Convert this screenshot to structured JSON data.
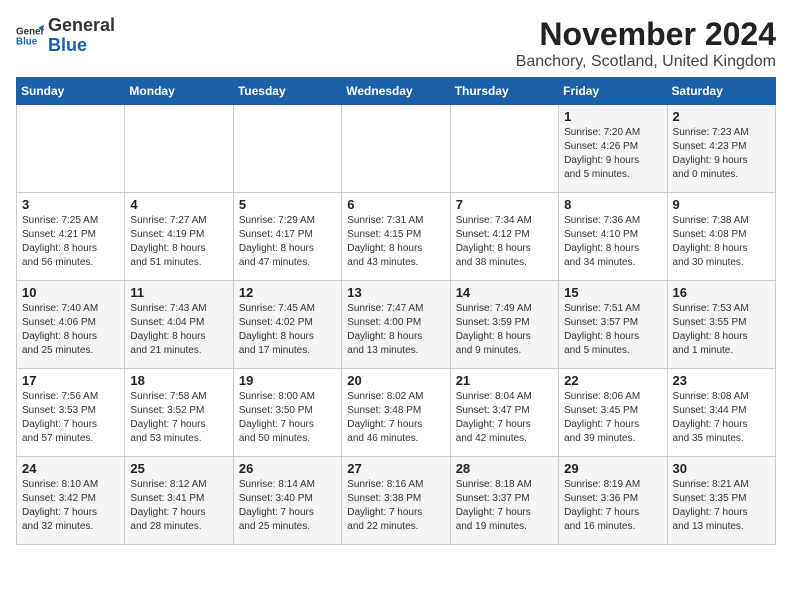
{
  "logo": {
    "general": "General",
    "blue": "Blue"
  },
  "title": "November 2024",
  "location": "Banchory, Scotland, United Kingdom",
  "days_header": [
    "Sunday",
    "Monday",
    "Tuesday",
    "Wednesday",
    "Thursday",
    "Friday",
    "Saturday"
  ],
  "weeks": [
    [
      {
        "day": "",
        "info": ""
      },
      {
        "day": "",
        "info": ""
      },
      {
        "day": "",
        "info": ""
      },
      {
        "day": "",
        "info": ""
      },
      {
        "day": "",
        "info": ""
      },
      {
        "day": "1",
        "info": "Sunrise: 7:20 AM\nSunset: 4:26 PM\nDaylight: 9 hours\nand 5 minutes."
      },
      {
        "day": "2",
        "info": "Sunrise: 7:23 AM\nSunset: 4:23 PM\nDaylight: 9 hours\nand 0 minutes."
      }
    ],
    [
      {
        "day": "3",
        "info": "Sunrise: 7:25 AM\nSunset: 4:21 PM\nDaylight: 8 hours\nand 56 minutes."
      },
      {
        "day": "4",
        "info": "Sunrise: 7:27 AM\nSunset: 4:19 PM\nDaylight: 8 hours\nand 51 minutes."
      },
      {
        "day": "5",
        "info": "Sunrise: 7:29 AM\nSunset: 4:17 PM\nDaylight: 8 hours\nand 47 minutes."
      },
      {
        "day": "6",
        "info": "Sunrise: 7:31 AM\nSunset: 4:15 PM\nDaylight: 8 hours\nand 43 minutes."
      },
      {
        "day": "7",
        "info": "Sunrise: 7:34 AM\nSunset: 4:12 PM\nDaylight: 8 hours\nand 38 minutes."
      },
      {
        "day": "8",
        "info": "Sunrise: 7:36 AM\nSunset: 4:10 PM\nDaylight: 8 hours\nand 34 minutes."
      },
      {
        "day": "9",
        "info": "Sunrise: 7:38 AM\nSunset: 4:08 PM\nDaylight: 8 hours\nand 30 minutes."
      }
    ],
    [
      {
        "day": "10",
        "info": "Sunrise: 7:40 AM\nSunset: 4:06 PM\nDaylight: 8 hours\nand 25 minutes."
      },
      {
        "day": "11",
        "info": "Sunrise: 7:43 AM\nSunset: 4:04 PM\nDaylight: 8 hours\nand 21 minutes."
      },
      {
        "day": "12",
        "info": "Sunrise: 7:45 AM\nSunset: 4:02 PM\nDaylight: 8 hours\nand 17 minutes."
      },
      {
        "day": "13",
        "info": "Sunrise: 7:47 AM\nSunset: 4:00 PM\nDaylight: 8 hours\nand 13 minutes."
      },
      {
        "day": "14",
        "info": "Sunrise: 7:49 AM\nSunset: 3:59 PM\nDaylight: 8 hours\nand 9 minutes."
      },
      {
        "day": "15",
        "info": "Sunrise: 7:51 AM\nSunset: 3:57 PM\nDaylight: 8 hours\nand 5 minutes."
      },
      {
        "day": "16",
        "info": "Sunrise: 7:53 AM\nSunset: 3:55 PM\nDaylight: 8 hours\nand 1 minute."
      }
    ],
    [
      {
        "day": "17",
        "info": "Sunrise: 7:56 AM\nSunset: 3:53 PM\nDaylight: 7 hours\nand 57 minutes."
      },
      {
        "day": "18",
        "info": "Sunrise: 7:58 AM\nSunset: 3:52 PM\nDaylight: 7 hours\nand 53 minutes."
      },
      {
        "day": "19",
        "info": "Sunrise: 8:00 AM\nSunset: 3:50 PM\nDaylight: 7 hours\nand 50 minutes."
      },
      {
        "day": "20",
        "info": "Sunrise: 8:02 AM\nSunset: 3:48 PM\nDaylight: 7 hours\nand 46 minutes."
      },
      {
        "day": "21",
        "info": "Sunrise: 8:04 AM\nSunset: 3:47 PM\nDaylight: 7 hours\nand 42 minutes."
      },
      {
        "day": "22",
        "info": "Sunrise: 8:06 AM\nSunset: 3:45 PM\nDaylight: 7 hours\nand 39 minutes."
      },
      {
        "day": "23",
        "info": "Sunrise: 8:08 AM\nSunset: 3:44 PM\nDaylight: 7 hours\nand 35 minutes."
      }
    ],
    [
      {
        "day": "24",
        "info": "Sunrise: 8:10 AM\nSunset: 3:42 PM\nDaylight: 7 hours\nand 32 minutes."
      },
      {
        "day": "25",
        "info": "Sunrise: 8:12 AM\nSunset: 3:41 PM\nDaylight: 7 hours\nand 28 minutes."
      },
      {
        "day": "26",
        "info": "Sunrise: 8:14 AM\nSunset: 3:40 PM\nDaylight: 7 hours\nand 25 minutes."
      },
      {
        "day": "27",
        "info": "Sunrise: 8:16 AM\nSunset: 3:38 PM\nDaylight: 7 hours\nand 22 minutes."
      },
      {
        "day": "28",
        "info": "Sunrise: 8:18 AM\nSunset: 3:37 PM\nDaylight: 7 hours\nand 19 minutes."
      },
      {
        "day": "29",
        "info": "Sunrise: 8:19 AM\nSunset: 3:36 PM\nDaylight: 7 hours\nand 16 minutes."
      },
      {
        "day": "30",
        "info": "Sunrise: 8:21 AM\nSunset: 3:35 PM\nDaylight: 7 hours\nand 13 minutes."
      }
    ]
  ]
}
